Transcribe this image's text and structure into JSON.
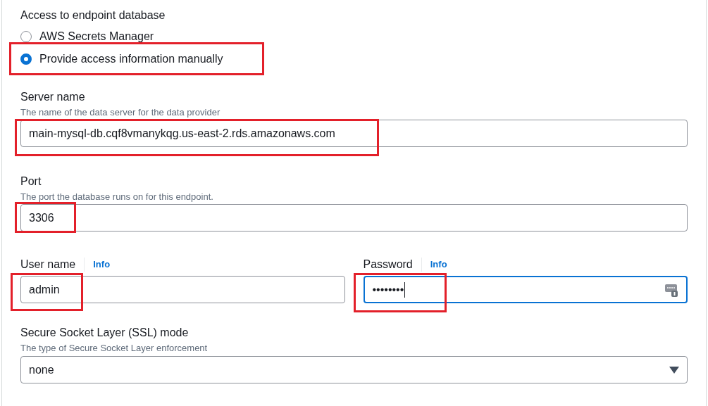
{
  "access": {
    "label": "Access to endpoint database",
    "options": [
      {
        "label": "AWS Secrets Manager",
        "selected": false,
        "highlighted": false
      },
      {
        "label": "Provide access information manually",
        "selected": true,
        "highlighted": true
      }
    ]
  },
  "server_name": {
    "label": "Server name",
    "description": "The name of the data server for the data provider",
    "value": "main-mysql-db.cqf8vmanykqg.us-east-2.rds.amazonaws.com",
    "highlighted": true
  },
  "port": {
    "label": "Port",
    "description": "The port the database runs on for this endpoint.",
    "value": "3306",
    "highlighted": true
  },
  "user_name": {
    "label": "User name",
    "info": "Info",
    "value": "admin",
    "highlighted": true
  },
  "password": {
    "label": "Password",
    "info": "Info",
    "value": "••••••••",
    "highlighted": true,
    "focused": true
  },
  "ssl_mode": {
    "label": "Secure Socket Layer (SSL) mode",
    "description": "The type of Secure Socket Layer enforcement",
    "value": "none"
  }
}
